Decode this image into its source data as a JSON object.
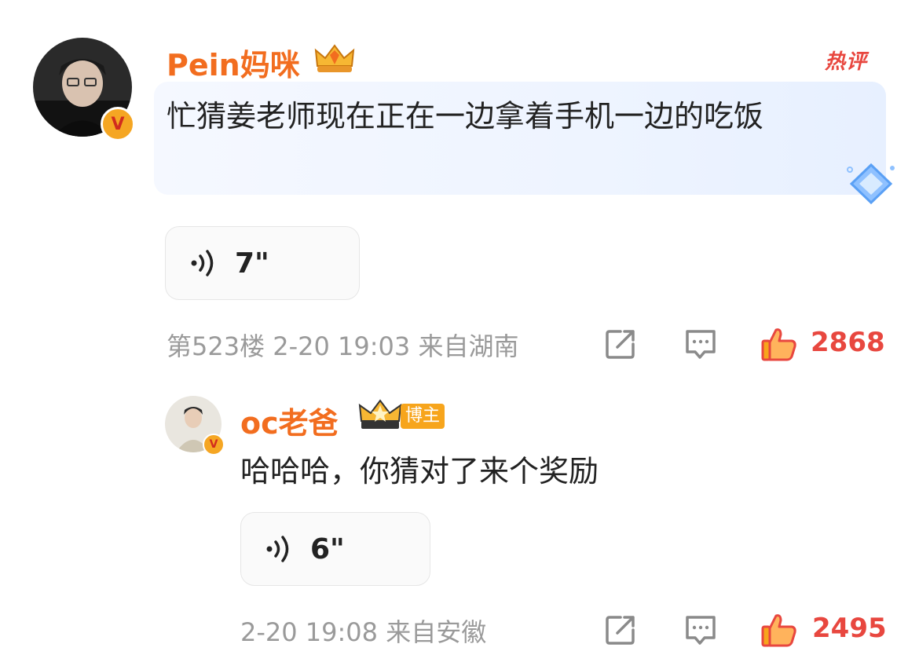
{
  "comment": {
    "username": "Pein妈咪",
    "hot_label": "热评",
    "text": "忙猜姜老师现在正在一边拿着手机一边的吃饭",
    "voice_duration": "7\"",
    "meta": "第523楼 2-20 19:03 来自湖南",
    "likes": "2868",
    "verified_mark": "V"
  },
  "reply": {
    "username": "oc老爸",
    "role_badge": "博主",
    "text": "哈哈哈，你猜对了来个奖励",
    "voice_duration": "6\"",
    "meta": "2-20 19:08 来自安徽",
    "likes": "2495",
    "verified_mark": "V"
  },
  "colors": {
    "accent": "#f26d1f",
    "like": "#e8473f",
    "meta": "#9a9a9a",
    "text": "#222222"
  },
  "icons": [
    "share-icon",
    "comment-icon",
    "thumbs-up-icon",
    "crown-icon",
    "diamond-icon",
    "voice-wave-icon"
  ]
}
